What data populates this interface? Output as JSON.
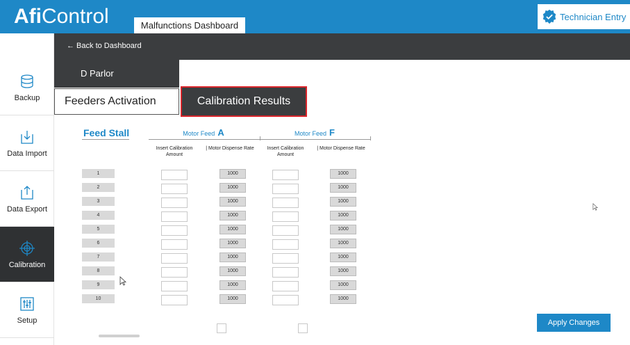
{
  "header": {
    "logo_bold": "Afi",
    "logo_light": "Control",
    "dashboard_tab": "Malfunctions Dashboard",
    "technician_button": "Technician Entry"
  },
  "sidebar": {
    "items": [
      {
        "label": "Backup",
        "icon": "database-icon"
      },
      {
        "label": "Data Import",
        "icon": "import-icon"
      },
      {
        "label": "Data Export",
        "icon": "export-icon"
      },
      {
        "label": "Calibration",
        "icon": "crosshair-icon"
      },
      {
        "label": "Setup",
        "icon": "sliders-icon"
      }
    ],
    "active": "Calibration"
  },
  "subbar": {
    "back_label": "← Back to Dashboard"
  },
  "parlor": {
    "label": "D   Parlor"
  },
  "tabs": {
    "feeders": "Feeders Activation",
    "calibration": "Calibration Results"
  },
  "table": {
    "stall_header": "Feed Stall",
    "motor_a_prefix": "Motor Feed",
    "motor_a_letter": "A",
    "motor_f_prefix": "Motor Feed",
    "motor_f_letter": "F",
    "sub_insert_a": "Insert Calibration Amount",
    "sub_rate_a": "| Motor Dispense Rate",
    "sub_insert_f": "Insert Calibration Amount",
    "sub_rate_f": "| Motor Dispense Rate",
    "rows": [
      {
        "stall": "1",
        "rate_a": "1000",
        "rate_f": "1000"
      },
      {
        "stall": "2",
        "rate_a": "1000",
        "rate_f": "1000"
      },
      {
        "stall": "3",
        "rate_a": "1000",
        "rate_f": "1000"
      },
      {
        "stall": "4",
        "rate_a": "1000",
        "rate_f": "1000"
      },
      {
        "stall": "5",
        "rate_a": "1000",
        "rate_f": "1000"
      },
      {
        "stall": "6",
        "rate_a": "1000",
        "rate_f": "1000"
      },
      {
        "stall": "7",
        "rate_a": "1000",
        "rate_f": "1000"
      },
      {
        "stall": "8",
        "rate_a": "1000",
        "rate_f": "1000"
      },
      {
        "stall": "9",
        "rate_a": "1000",
        "rate_f": "1000"
      },
      {
        "stall": "10",
        "rate_a": "1000",
        "rate_f": "1000"
      }
    ]
  },
  "actions": {
    "apply": "Apply Changes"
  },
  "colors": {
    "brand_blue": "#1e88c7",
    "dark_bar": "#3b3d3f",
    "highlight_red": "#d9252b"
  }
}
